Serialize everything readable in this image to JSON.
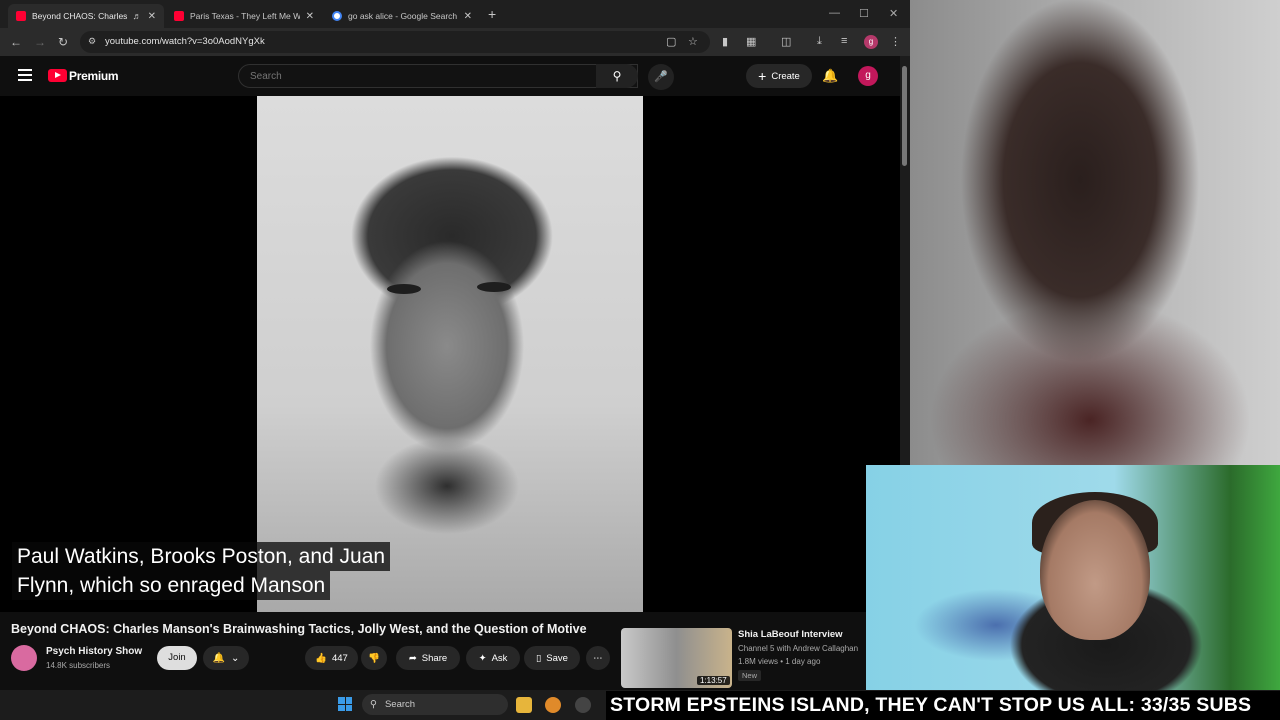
{
  "browser": {
    "tabs": [
      {
        "title": "Beyond CHAOS: Charles M",
        "active": true,
        "favicon": "youtube-icon"
      },
      {
        "title": "Paris Texas - They Left Me With",
        "active": false,
        "favicon": "youtube-icon"
      },
      {
        "title": "go ask alice - Google Search",
        "active": false,
        "favicon": "google-icon"
      }
    ],
    "url": "youtube.com/watch?v=3o0AodNYgXk"
  },
  "youtube": {
    "logo_text": "Premium",
    "search_placeholder": "Search",
    "create_label": "Create",
    "avatar_letter": "g"
  },
  "video": {
    "captions": [
      "Paul Watkins, Brooks Poston, and Juan",
      "Flynn, which so enraged Manson"
    ],
    "title": "Beyond CHAOS: Charles Manson's Brainwashing Tactics, Jolly West, and the Question of Motive",
    "channel_name": "Psych History Show",
    "subscribers": "14.8K subscribers",
    "join_label": "Join",
    "like_count": "447",
    "share_label": "Share",
    "ask_label": "Ask",
    "save_label": "Save"
  },
  "recommendation": {
    "title": "Shia LaBeouf Interview",
    "channel": "Channel 5 with Andrew Callaghan",
    "meta": "1.8M views • 1 day ago",
    "badge": "New",
    "duration": "1:13:57"
  },
  "taskbar": {
    "search_label": "Search"
  },
  "ticker": {
    "text": "STORM EPSTEINS ISLAND, THEY CAN'T STOP US ALL: 33/35 SUBS"
  },
  "colors": {
    "yt_red": "#ff0033",
    "background": "#0f0f0f"
  }
}
